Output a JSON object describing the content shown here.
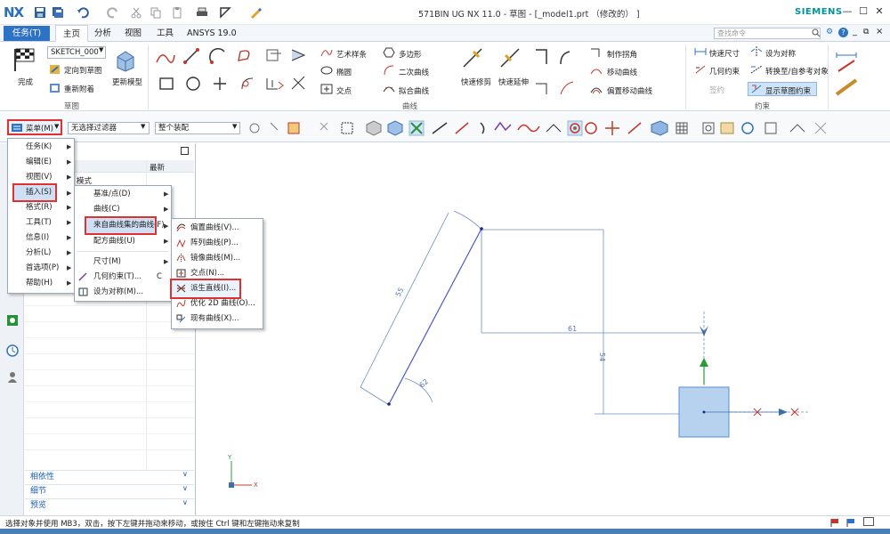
{
  "app": {
    "logo": "NX",
    "title": "571BIN UG NX 11.0 - 草图 - [_model1.prt （修改的） ]",
    "brand": "SIEMENS",
    "accent": "#2d72c4",
    "highlight": "#e03030"
  },
  "tabs": {
    "task": "任务(T)",
    "items": [
      "主页",
      "分析",
      "视图",
      "工具",
      "ANSYS 19.0"
    ]
  },
  "search": {
    "placeholder": "查找命令"
  },
  "ribbon": {
    "sketch_group": {
      "finish": "完成",
      "sketch_name": "SKETCH_000",
      "orient": "定向到草图",
      "reattach": "重新附着",
      "update_model": "更新模型",
      "label": "草图"
    },
    "curve_group": {
      "studio_spline": "艺术样条",
      "polygon": "多边形",
      "ellipse": "椭圆",
      "conic": "二次曲线",
      "point": "交点",
      "fit_curve": "拟合曲线",
      "quick_trim": "快速修剪",
      "quick_extend": "快速延伸",
      "make_corner": "制作拐角",
      "move_curve": "移动曲线",
      "offset_move": "偏置移动曲线",
      "label": "曲线"
    },
    "constraint_group": {
      "rapid_dim": "快速尺寸",
      "geo_constraint": "几何约束",
      "design_constraint": "签约",
      "make_symmetric": "设为对称",
      "convert_ref": "转换至/自参考对象",
      "show_constraints": "显示草图约束",
      "label": "约束"
    }
  },
  "toolbar2": {
    "menu_label": "菜单(M)",
    "filter": "无选择过滤器",
    "assembly": "整个装配"
  },
  "navpanel": {
    "col_latest": "最新",
    "row1": "模式",
    "accordions": [
      "相依性",
      "细节",
      "预览"
    ]
  },
  "main_menu": {
    "items": [
      "任务(K)",
      "编辑(E)",
      "视图(V)",
      "插入(S)",
      "格式(R)",
      "工具(T)",
      "信息(I)",
      "分析(L)",
      "首选项(P)",
      "帮助(H)"
    ]
  },
  "insert_menu": {
    "items": [
      "基准/点(D)",
      "曲线(C)",
      "来自曲线集的曲线(F)",
      "配方曲线(U)",
      "尺寸(M)",
      "几何约束(T)...",
      "设为对称(M)..."
    ],
    "shortcut": "C"
  },
  "curves_menu": {
    "items": [
      "偏置曲线(V)...",
      "阵列曲线(P)...",
      "镜像曲线(M)...",
      "交点(N)...",
      "派生直线(I)...",
      "优化 2D 曲线(O)...",
      "现有曲线(X)..."
    ]
  },
  "sketch": {
    "dim_length": "55",
    "dim_horizontal": "61",
    "dim_vertical": "54",
    "dim_angle": "62"
  },
  "triad": {
    "x": "X",
    "y": "Y"
  },
  "status": {
    "text": "选择对象并使用 MB3，双击，按下左键并拖动来移动，或按住 Ctrl 键和左键拖动来复制"
  }
}
